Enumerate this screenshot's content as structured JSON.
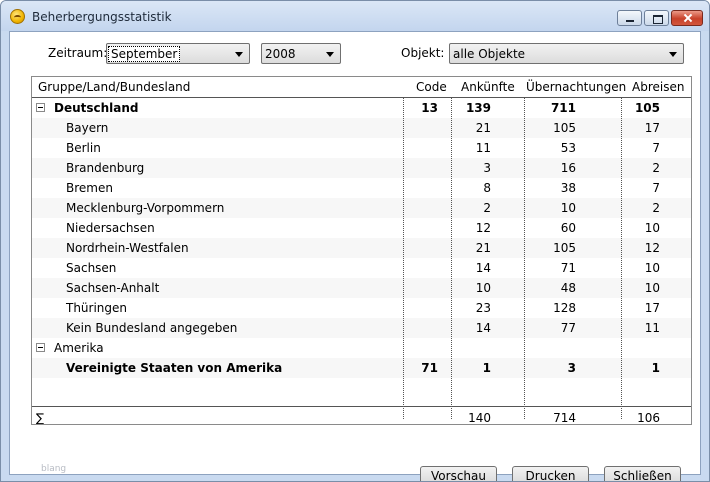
{
  "window": {
    "title": "Beherbergungsstatistik"
  },
  "filters": {
    "period_label": "Zeitraum:",
    "month_value": "September",
    "year_value": "2008",
    "object_label": "Objekt:",
    "object_value": "alle Objekte"
  },
  "table": {
    "columns": [
      "Gruppe/Land/Bundesland",
      "Code",
      "Ankünfte",
      "Übernachtungen",
      "Abreisen"
    ],
    "rows": [
      {
        "name": "Deutschland",
        "code": "13",
        "arrivals": "139",
        "nights": "711",
        "departures": "105",
        "level": "group",
        "bold": true,
        "expanded": true
      },
      {
        "name": "Bayern",
        "code": "",
        "arrivals": "21",
        "nights": "105",
        "departures": "17",
        "level": "item"
      },
      {
        "name": "Berlin",
        "code": "",
        "arrivals": "11",
        "nights": "53",
        "departures": "7",
        "level": "item"
      },
      {
        "name": "Brandenburg",
        "code": "",
        "arrivals": "3",
        "nights": "16",
        "departures": "2",
        "level": "item"
      },
      {
        "name": "Bremen",
        "code": "",
        "arrivals": "8",
        "nights": "38",
        "departures": "7",
        "level": "item"
      },
      {
        "name": "Mecklenburg-Vorpommern",
        "code": "",
        "arrivals": "2",
        "nights": "10",
        "departures": "2",
        "level": "item"
      },
      {
        "name": "Niedersachsen",
        "code": "",
        "arrivals": "12",
        "nights": "60",
        "departures": "10",
        "level": "item"
      },
      {
        "name": "Nordrhein-Westfalen",
        "code": "",
        "arrivals": "21",
        "nights": "105",
        "departures": "12",
        "level": "item"
      },
      {
        "name": "Sachsen",
        "code": "",
        "arrivals": "14",
        "nights": "71",
        "departures": "10",
        "level": "item"
      },
      {
        "name": "Sachsen-Anhalt",
        "code": "",
        "arrivals": "10",
        "nights": "48",
        "departures": "10",
        "level": "item"
      },
      {
        "name": "Thüringen",
        "code": "",
        "arrivals": "23",
        "nights": "128",
        "departures": "17",
        "level": "item"
      },
      {
        "name": "Kein Bundesland angegeben",
        "code": "",
        "arrivals": "14",
        "nights": "77",
        "departures": "11",
        "level": "item"
      },
      {
        "name": "Amerika",
        "code": "",
        "arrivals": "",
        "nights": "",
        "departures": "",
        "level": "group",
        "bold": false,
        "expanded": true
      },
      {
        "name": "Vereinigte Staaten von Amerika",
        "code": "71",
        "arrivals": "1",
        "nights": "3",
        "departures": "1",
        "level": "item",
        "bold": true
      }
    ],
    "totals": {
      "label": "∑",
      "arrivals": "140",
      "nights": "714",
      "departures": "106"
    }
  },
  "faint_text": "blang",
  "buttons": {
    "preview": "Vorschau",
    "print": "Drucken",
    "close": "Schließen"
  },
  "icons": {
    "app": "sun-icon",
    "minimize": "minimize-icon",
    "maximize": "maximize-icon",
    "close": "close-icon",
    "collapse": "collapse-icon",
    "dropdown": "chevron-down-icon"
  }
}
